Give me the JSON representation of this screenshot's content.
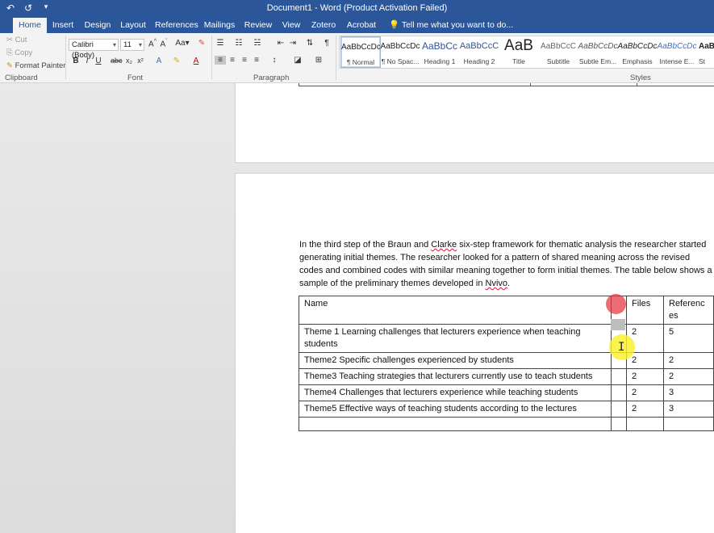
{
  "window": {
    "title": "Document1 - Word (Product Activation Failed)",
    "qat_icons": [
      "undo-icon",
      "redo-icon",
      "customize-icon"
    ]
  },
  "tabs": [
    {
      "label": "Home",
      "active": true
    },
    {
      "label": "Insert"
    },
    {
      "label": "Design"
    },
    {
      "label": "Layout"
    },
    {
      "label": "References"
    },
    {
      "label": "Mailings"
    },
    {
      "label": "Review"
    },
    {
      "label": "View"
    },
    {
      "label": "Zotero"
    },
    {
      "label": "Acrobat"
    }
  ],
  "tell_me": "Tell me what you want to do...",
  "clipboard": {
    "cut": "Cut",
    "copy": "Copy",
    "format_painter": "Format Painter",
    "label": "Clipboard"
  },
  "font": {
    "name": "Calibri (Body)",
    "size": "11",
    "label": "Font"
  },
  "paragraph": {
    "label": "Paragraph"
  },
  "styles": {
    "label": "Styles",
    "items": [
      {
        "preview": "AaBbCcDc",
        "name": "¶ Normal",
        "selected": true
      },
      {
        "preview": "AaBbCcDc",
        "name": "¶ No Spac..."
      },
      {
        "preview": "AaBbCc",
        "name": "Heading 1"
      },
      {
        "preview": "AaBbCcC",
        "name": "Heading 2"
      },
      {
        "preview": "AaB",
        "name": "Title"
      },
      {
        "preview": "AaBbCcC",
        "name": "Subtitle"
      },
      {
        "preview": "AaBbCcDc",
        "name": "Subtle Em..."
      },
      {
        "preview": "AaBbCcDc",
        "name": "Emphasis"
      },
      {
        "preview": "AaBbCcDc",
        "name": "Intense E..."
      },
      {
        "preview": "AaB",
        "name": "St"
      }
    ]
  },
  "document": {
    "paragraph_parts": [
      "In the third step of the Braun and ",
      "Clarke",
      " six-step framework for thematic analysis the researcher started generating initial themes. The researcher looked for a pattern of shared meaning across the revised codes and combined codes with similar meaning together to form initial themes. The table below shows a sample of the preliminary themes developed in ",
      "Nvivo",
      "."
    ],
    "table": {
      "headers": [
        "Name",
        "",
        "Files",
        "Referenc es"
      ],
      "rows": [
        [
          "Theme 1 Learning challenges that lecturers experience when teaching students",
          "",
          "2",
          "5"
        ],
        [
          "Theme2 Specific challenges experienced by students",
          "",
          "2",
          "2"
        ],
        [
          "Theme3 Teaching strategies that lecturers currently use to teach students",
          "",
          "2",
          "2"
        ],
        [
          "Theme4 Challenges that lecturers experience while teaching students",
          "",
          "2",
          "3"
        ],
        [
          "Theme5 Effective ways of teaching students according to the lectures",
          "",
          "2",
          "3"
        ],
        [
          "",
          "",
          "",
          ""
        ]
      ]
    }
  }
}
